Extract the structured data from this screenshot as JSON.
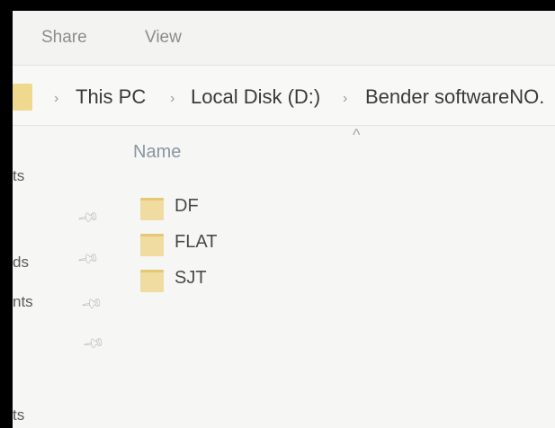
{
  "ribbon": {
    "tabs": [
      {
        "label": "Share"
      },
      {
        "label": "View"
      }
    ]
  },
  "address_bar": {
    "breadcrumbs": [
      {
        "label": "This PC"
      },
      {
        "label": "Local Disk (D:)"
      },
      {
        "label": "Bender softwareNO."
      }
    ],
    "separator": "›"
  },
  "nav_pane": {
    "items": [
      {
        "label": "ts"
      },
      {
        "label": "ds"
      },
      {
        "label": "nts"
      },
      {
        "label": "ts"
      }
    ]
  },
  "file_list": {
    "column_header": "Name",
    "sort_indicator": "^",
    "folders": [
      {
        "name": "DF"
      },
      {
        "name": "FLAT"
      },
      {
        "name": "SJT"
      }
    ]
  },
  "icons": {
    "folder": "folder-icon",
    "pin": "pin-icon"
  },
  "colors": {
    "folder_fill": "#f0dca0",
    "folder_tab": "#e6c874",
    "column_header": "#8a95a3"
  }
}
